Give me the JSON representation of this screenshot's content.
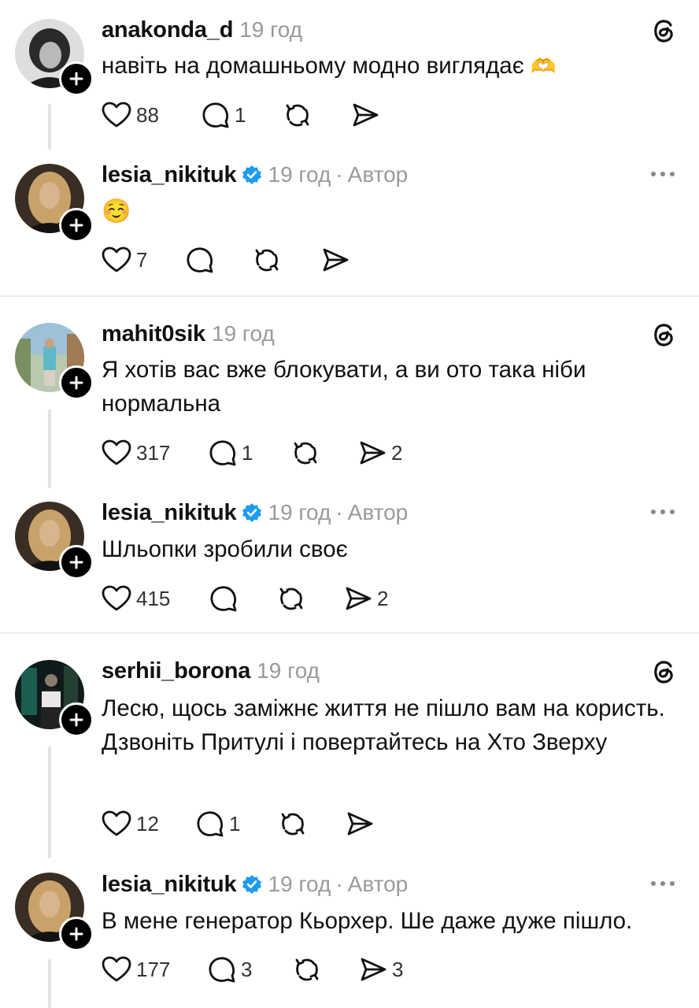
{
  "posts": [
    {
      "username": "anakonda_d",
      "time": "19 год",
      "author": "",
      "text": "навіть на домашньому модно виглядає",
      "emoji": "🫶",
      "likes": "88",
      "replies": "1",
      "reposts": "",
      "shares": "",
      "corner": "threads-logo-icon"
    },
    {
      "username": "lesia_nikituk",
      "time": "19 год",
      "author": "Автор",
      "text": "",
      "emoji": "☺️",
      "likes": "7",
      "replies": "",
      "reposts": "",
      "shares": "",
      "corner": "more-icon"
    },
    {
      "username": "mahit0sik",
      "time": "19 год",
      "author": "",
      "text": "Я хотів вас вже блокувати, а ви ото така ніби нормальна",
      "emoji": "",
      "likes": "317",
      "replies": "1",
      "reposts": "",
      "shares": "2",
      "corner": "threads-logo-icon"
    },
    {
      "username": "lesia_nikituk",
      "time": "19 год",
      "author": "Автор",
      "text": "Шльопки зробили своє",
      "emoji": "",
      "likes": "415",
      "replies": "",
      "reposts": "",
      "shares": "2",
      "corner": "more-icon"
    },
    {
      "username": "serhii_borona",
      "time": "19 год",
      "author": "",
      "text": "Лесю, щось заміжнє життя не пішло вам на користь. Дзвоніть Притулі і повертайтесь на Хто Зверху",
      "emoji": "",
      "likes": "12",
      "replies": "1",
      "reposts": "",
      "shares": "",
      "corner": "threads-logo-icon"
    },
    {
      "username": "lesia_nikituk",
      "time": "19 год",
      "author": "Автор",
      "text": "В мене генератор Кьорхер. Ше даже дуже пішло.",
      "emoji": "",
      "likes": "177",
      "replies": "3",
      "reposts": "",
      "shares": "3",
      "corner": "more-icon"
    }
  ],
  "separator": "·",
  "colors": {
    "text": "#111111",
    "muted": "#9a9a9a",
    "verified": "#1d9bf0",
    "divider": "#ececec",
    "thread_line": "#e3e3e3"
  }
}
